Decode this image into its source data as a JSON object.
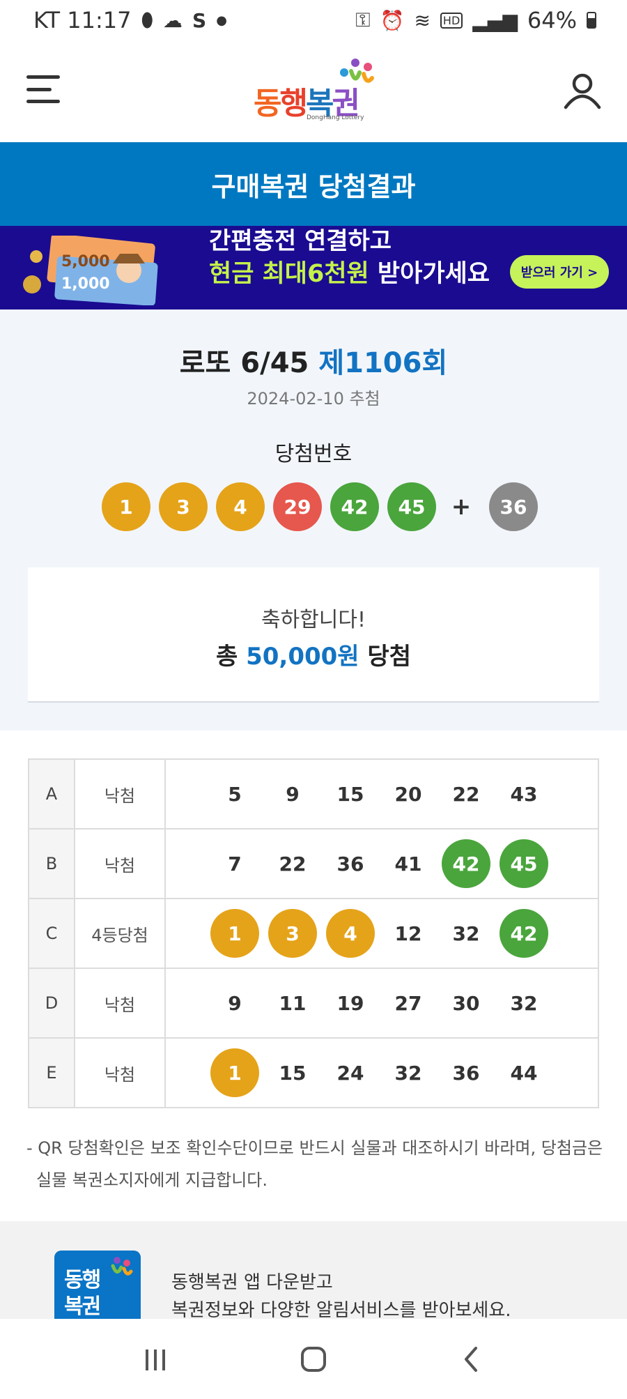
{
  "status_bar": {
    "carrier_time": "KT 11:17",
    "battery": "64%",
    "icons": [
      "pill-icon",
      "cloud-icon",
      "s-app-icon",
      "dot-icon",
      "key-icon",
      "alarm-icon",
      "wifi-icon",
      "hd-icon",
      "signal-icon",
      "battery-icon"
    ]
  },
  "header": {
    "logo_text": "동행복권",
    "logo_sub": "DongHang Lottery",
    "menu_icon": "hamburger-menu-icon",
    "user_icon": "user-icon"
  },
  "title_bar": {
    "title": "구매복권 당첨결과"
  },
  "banner": {
    "line1": "간편충전 연결하고",
    "line2_highlight": "현금 최대6천원",
    "line2_rest": " 받아가세요",
    "button": "받으러 가기 >",
    "bill1": "5,000",
    "bill2": "1,000"
  },
  "result": {
    "game_name": "로또 6/45 ",
    "round": "제1106회",
    "draw_date": "2024-02-10 추첨",
    "win_label": "당첨번호",
    "winning_numbers": [
      "1",
      "3",
      "4",
      "29",
      "42",
      "45"
    ],
    "plus": "+",
    "bonus_number": "36",
    "congrats": "축하합니다!",
    "total_prefix": "총 ",
    "total_amount": "50,000원",
    "total_suffix": " 당첨"
  },
  "games": [
    {
      "id": "A",
      "result": "낙첨",
      "numbers": [
        "5",
        "9",
        "15",
        "20",
        "22",
        "43"
      ],
      "colors": [
        "",
        "",
        "",
        "",
        "",
        ""
      ]
    },
    {
      "id": "B",
      "result": "낙첨",
      "numbers": [
        "7",
        "22",
        "36",
        "41",
        "42",
        "45"
      ],
      "colors": [
        "",
        "",
        "",
        "",
        "g",
        "g"
      ]
    },
    {
      "id": "C",
      "result": "4등당첨",
      "numbers": [
        "1",
        "3",
        "4",
        "12",
        "32",
        "42"
      ],
      "colors": [
        "y",
        "y",
        "y",
        "",
        "",
        "g"
      ]
    },
    {
      "id": "D",
      "result": "낙첨",
      "numbers": [
        "9",
        "11",
        "19",
        "27",
        "30",
        "32"
      ],
      "colors": [
        "",
        "",
        "",
        "",
        "",
        ""
      ]
    },
    {
      "id": "E",
      "result": "낙첨",
      "numbers": [
        "1",
        "15",
        "24",
        "32",
        "36",
        "44"
      ],
      "colors": [
        "y",
        "",
        "",
        "",
        "",
        ""
      ]
    }
  ],
  "notice": "- QR 당첨확인은 보조 확인수단이므로 반드시 실물과 대조하시기 바라며, 당첨금은 실물 복권소지자에게 지급합니다.",
  "promo": {
    "icon_text": "동행복권",
    "line1": "동행복권 앱 다운받고",
    "line2": "복권정보와 다양한 알림서비스를 받아보세요."
  },
  "nav": [
    "recents-icon",
    "home-icon",
    "back-icon"
  ],
  "colors": {
    "primary": "#0078c1",
    "ball_yellow": "#e5a31a",
    "ball_red": "#e6574d",
    "ball_green": "#4aa53c",
    "ball_gray": "#8a8a8a",
    "banner_bg": "#1a0b91"
  }
}
